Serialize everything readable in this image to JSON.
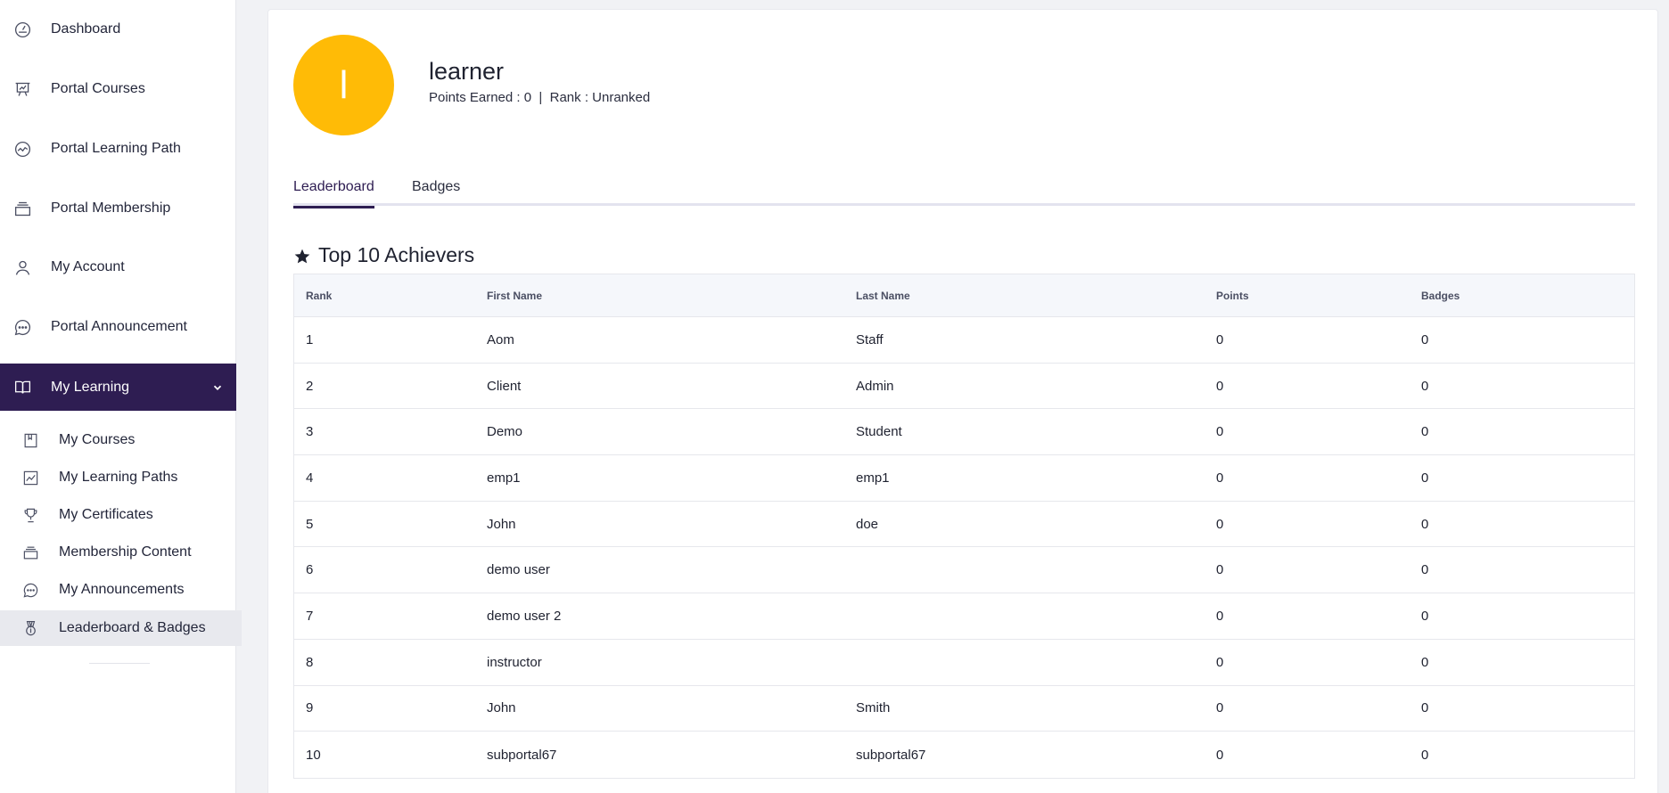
{
  "sidebar": {
    "items": [
      {
        "label": "Dashboard",
        "icon": "gauge-icon"
      },
      {
        "label": "Portal Courses",
        "icon": "presentation-chart-icon"
      },
      {
        "label": "Portal Learning Path",
        "icon": "route-circle-icon"
      },
      {
        "label": "Portal Membership",
        "icon": "layers-icon"
      },
      {
        "label": "My Account",
        "icon": "user-icon"
      },
      {
        "label": "Portal Announcement",
        "icon": "chat-bubble-icon"
      },
      {
        "label": "My Learning",
        "icon": "open-book-icon"
      }
    ],
    "sub_items": [
      {
        "label": "My Courses",
        "icon": "bookmark-book-icon"
      },
      {
        "label": "My Learning Paths",
        "icon": "image-chart-icon"
      },
      {
        "label": "My Certificates",
        "icon": "trophy-icon"
      },
      {
        "label": "Membership Content",
        "icon": "layers-icon"
      },
      {
        "label": "My Announcements",
        "icon": "chat-bubble-icon"
      },
      {
        "label": "Leaderboard & Badges",
        "icon": "medal-icon"
      }
    ]
  },
  "profile": {
    "initial": "l",
    "name": "learner",
    "stats": "Points Earned : 0  |  Rank : Unranked",
    "avatar_color": "#ffbb06"
  },
  "tabs": {
    "leaderboard": "Leaderboard",
    "badges": "Badges"
  },
  "section_title": "Top 10 Achievers",
  "table": {
    "headers": [
      "Rank",
      "First Name",
      "Last Name",
      "Points",
      "Badges"
    ],
    "rows": [
      [
        "1",
        "Aom",
        "Staff",
        "0",
        "0"
      ],
      [
        "2",
        "Client",
        "Admin",
        "0",
        "0"
      ],
      [
        "3",
        "Demo",
        "Student",
        "0",
        "0"
      ],
      [
        "4",
        "emp1",
        "emp1",
        "0",
        "0"
      ],
      [
        "5",
        "John",
        "doe",
        "0",
        "0"
      ],
      [
        "6",
        "demo user",
        "",
        "0",
        "0"
      ],
      [
        "7",
        "demo user 2",
        "",
        "0",
        "0"
      ],
      [
        "8",
        "instructor",
        "",
        "0",
        "0"
      ],
      [
        "9",
        "John",
        "Smith",
        "0",
        "0"
      ],
      [
        "10",
        "subportal67",
        "subportal67",
        "0",
        "0"
      ]
    ]
  },
  "colors": {
    "accent": "#2e1d52",
    "avatar": "#ffbb06"
  }
}
